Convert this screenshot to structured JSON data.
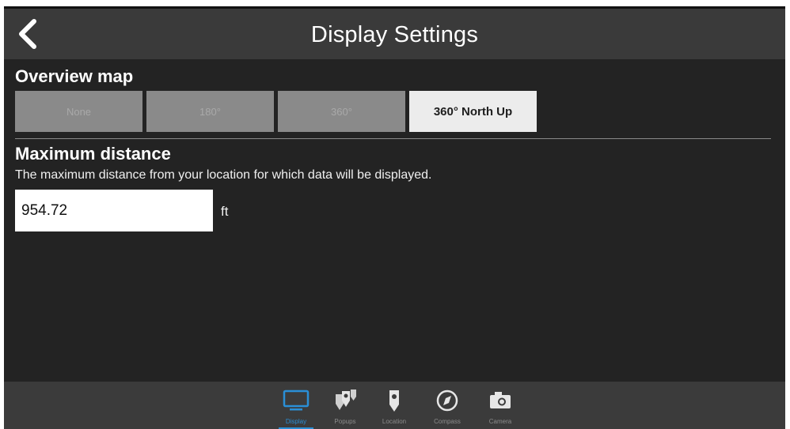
{
  "header": {
    "title": "Display Settings",
    "back_icon": "chevron-left-icon"
  },
  "overview_map": {
    "title": "Overview map",
    "options": [
      "None",
      "180°",
      "360°",
      "360° North Up"
    ],
    "selected": "360° North Up"
  },
  "max_distance": {
    "title": "Maximum distance",
    "description": "The maximum distance from your location for which data will be displayed.",
    "value": "954.72",
    "unit": "ft"
  },
  "tabs": [
    {
      "label": "Display",
      "icon": "monitor-icon",
      "active": true
    },
    {
      "label": "Popups",
      "icon": "popups-icon",
      "active": false
    },
    {
      "label": "Location",
      "icon": "location-pin-icon",
      "active": false
    },
    {
      "label": "Compass",
      "icon": "compass-icon",
      "active": false
    },
    {
      "label": "Camera",
      "icon": "camera-icon",
      "active": false
    }
  ],
  "colors": {
    "background": "#232323",
    "header": "#3a3a3a",
    "accent": "#2a8fd6",
    "segment_unselected": "#8a8a8a",
    "segment_selected": "#ececec"
  }
}
